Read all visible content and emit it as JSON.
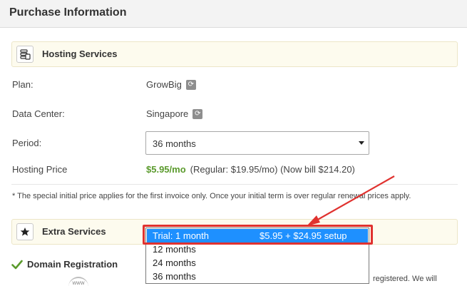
{
  "header": {
    "title": "Purchase Information"
  },
  "hosting": {
    "section_label": "Hosting Services",
    "section_icon": "server-stack-icon",
    "plan_label": "Plan:",
    "plan_value": "GrowBig",
    "datacenter_label": "Data Center:",
    "datacenter_value": "Singapore",
    "period_label": "Period:",
    "period_selected": "36 months",
    "price_label": "Hosting Price",
    "price_value": "$5.95/mo",
    "price_note": "(Regular: $19.95/mo) (Now bill $214.20)"
  },
  "footnote": "* The special initial price applies for the first invoice only. Once your initial term is over regular renewal prices apply.",
  "extra": {
    "section_label": "Extra Services",
    "section_icon": "star-icon"
  },
  "period_dropdown": {
    "options": [
      {
        "label": "Trial: 1 month",
        "price": "$5.95 + $24.95 setup",
        "selected": true
      },
      {
        "label": "12 months",
        "price": "",
        "selected": false
      },
      {
        "label": "24 months",
        "price": "",
        "selected": false
      },
      {
        "label": "36 months",
        "price": "",
        "selected": false
      }
    ]
  },
  "domain": {
    "label": "Domain Registration",
    "icon": "checkmark-icon",
    "partial_text": "registered. We will",
    "www_icon": "www-icon",
    "www_text": "WWW"
  },
  "annotation": {
    "color": "#e0322f"
  },
  "colors": {
    "price_green": "#5a9a2c",
    "select_blue": "#1e90ff",
    "section_bg": "#fdfbee"
  }
}
